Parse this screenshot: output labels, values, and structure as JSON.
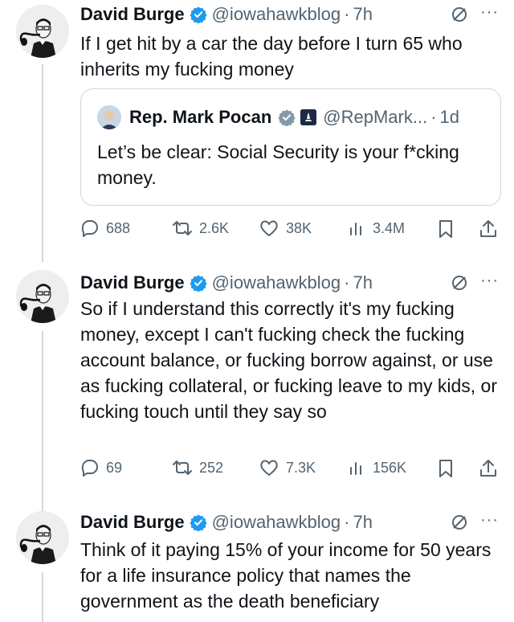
{
  "tweets": [
    {
      "author": {
        "name": "David Burge",
        "handle": "@iowahawkblog",
        "sep": "·",
        "time": "7h"
      },
      "more_label": "···",
      "text": "If I get hit by a car the day before I turn 65 who inherits my fucking money",
      "quote": {
        "author": {
          "name": "Rep. Mark Pocan",
          "handle": "@RepMark...",
          "sep": "·",
          "time": "1d"
        },
        "text": "Let’s be clear: Social Security is your f*cking money."
      },
      "stats": {
        "replies": "688",
        "reposts": "2.6K",
        "likes": "38K",
        "views": "3.4M"
      }
    },
    {
      "author": {
        "name": "David Burge",
        "handle": "@iowahawkblog",
        "sep": "·",
        "time": "7h"
      },
      "more_label": "···",
      "text": "So if I understand this correctly it's my fucking money, except I can't fucking check the fucking account balance, or fucking borrow against, or use as fucking collateral, or fucking leave to my kids, or fucking touch until they say so",
      "stats": {
        "replies": "69",
        "reposts": "252",
        "likes": "7.3K",
        "views": "156K"
      }
    },
    {
      "author": {
        "name": "David Burge",
        "handle": "@iowahawkblog",
        "sep": "·",
        "time": "7h"
      },
      "more_label": "···",
      "text": "Think of it paying 15% of your income for 50 years for a life insurance policy that names the government as the death beneficiary"
    }
  ],
  "icons": {
    "verified": "verified-badge-icon",
    "grok": "grok-icon",
    "reply": "reply-icon",
    "repost": "repost-icon",
    "like": "like-icon",
    "views": "views-icon",
    "bookmark": "bookmark-icon",
    "share": "share-icon"
  },
  "colors": {
    "verified": "#1d9bf0",
    "secondary_text": "#536471",
    "border": "#cfd9de"
  }
}
